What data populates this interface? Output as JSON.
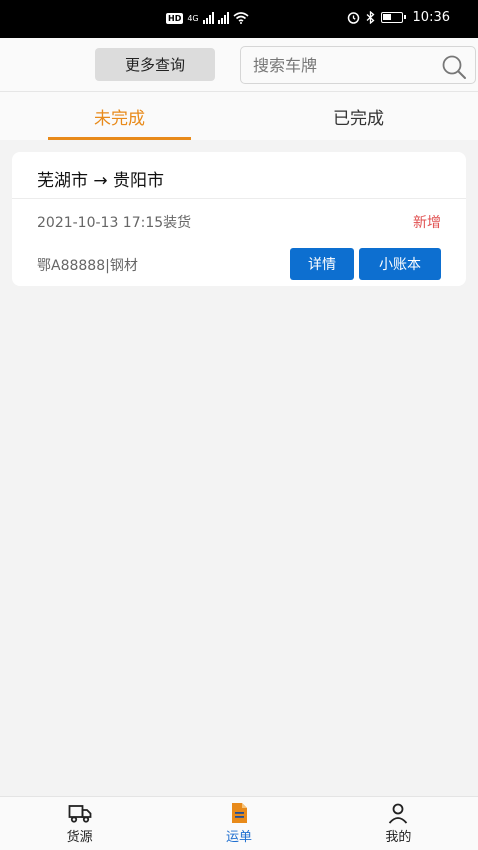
{
  "status_bar": {
    "network_badge": "HD",
    "network_type": "4G",
    "time": "10:36"
  },
  "query_bar": {
    "more_query_label": "更多查询",
    "search_placeholder": "搜索车牌"
  },
  "tabs": [
    {
      "label": "未完成",
      "active": true
    },
    {
      "label": "已完成",
      "active": false
    }
  ],
  "orders": [
    {
      "route": "芜湖市 → 贵阳市",
      "load_time": "2021-10-13 17:15装货",
      "status": "新增",
      "plate_cargo": "鄂A88888|钢材",
      "detail_label": "详情",
      "ledger_label": "小账本"
    }
  ],
  "bottom_nav": [
    {
      "label": "货源",
      "icon": "truck-icon",
      "active": false
    },
    {
      "label": "运单",
      "icon": "document-icon",
      "active": true
    },
    {
      "label": "我的",
      "icon": "person-icon",
      "active": false
    }
  ],
  "colors": {
    "accent_orange": "#e88a1a",
    "button_blue": "#0d6fd0",
    "status_red": "#e05050",
    "nav_active": "#1f6fd0"
  }
}
